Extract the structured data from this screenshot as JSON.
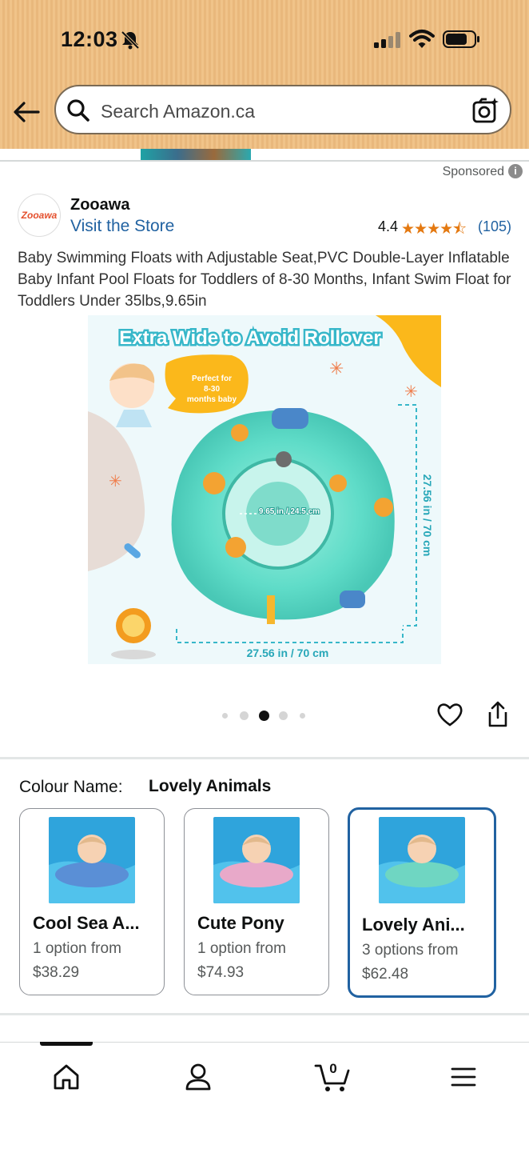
{
  "status_bar": {
    "time": "12:03"
  },
  "search": {
    "placeholder": "Search Amazon.ca"
  },
  "ad": {
    "sponsored_label": "Sponsored",
    "info_icon": "i",
    "store_logo_text": "Zooawa",
    "store_name": "Zooawa",
    "visit_store": "Visit the Store",
    "rating_value": "4.4",
    "stars": "★★★★⯪",
    "review_count": "(105)",
    "product_title": "Baby Swimming Floats with Adjustable Seat,PVC Double-Layer Inflatable Baby Infant Pool Floats for Toddlers of 8-30 Months, Infant Swim Float for Toddlers Under 35lbs,9.65in"
  },
  "product_image": {
    "banner": "Extra Wide to Avoid Rollover",
    "bubble_lines": [
      "Perfect for",
      "8-30",
      "months baby"
    ],
    "inner_dim": "9.65 in / 24.5 cm",
    "side_dim": "27.56 in / 70 cm",
    "bottom_dim": "27.56 in / 70 cm"
  },
  "carousel": {
    "count": 5,
    "active": 2
  },
  "colour": {
    "label": "Colour Name:",
    "value": "Lovely Animals",
    "options": [
      {
        "name": "Cool Sea A...",
        "sub": "1 option from",
        "price": "$38.29",
        "selected": false,
        "ring_color": "#5a8fd6"
      },
      {
        "name": "Cute Pony",
        "sub": "1 option from",
        "price": "$74.93",
        "selected": false,
        "ring_color": "#e8a9c9"
      },
      {
        "name": "Lovely Ani...",
        "sub": "3 options from",
        "price": "$62.48",
        "selected": true,
        "ring_color": "#6fd6c2"
      }
    ]
  },
  "nav": {
    "cart_count": "0",
    "items": [
      "home-icon",
      "account-icon",
      "cart-icon",
      "menu-icon"
    ]
  },
  "colors": {
    "header": "#f0c389",
    "link": "#2162a1",
    "star": "#e47911",
    "selected_border": "#2162a1"
  }
}
